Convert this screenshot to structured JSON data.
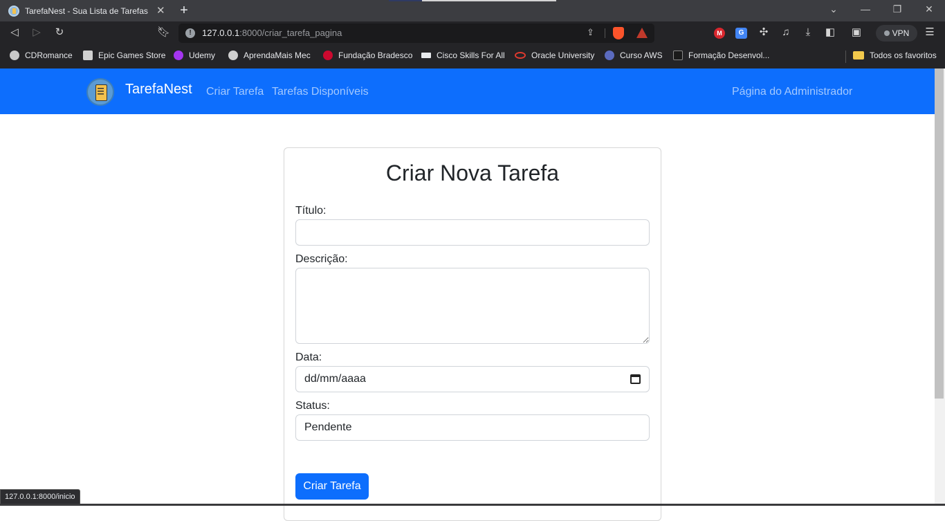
{
  "browser": {
    "tab_title": "TarefaNest - Sua Lista de Tarefas",
    "tab_close": "✕",
    "new_tab": "+",
    "url_host": "127.0.0.1",
    "url_rest": ":8000/criar_tarefa_pagina",
    "vpn_label": "VPN",
    "bookmarks": [
      {
        "label": "CDRomance",
        "icon_color": "#c9c9c9"
      },
      {
        "label": "Epic Games Store",
        "icon_color": "#d0d0d0"
      },
      {
        "label": "Udemy",
        "icon_color": "#a435f0"
      },
      {
        "label": "AprendaMais Mec",
        "icon_color": "#cfcfcf"
      },
      {
        "label": "Fundação Bradesco",
        "icon_color": "#cc092f"
      },
      {
        "label": "Cisco Skills For All",
        "icon_color": "#e8eaed"
      },
      {
        "label": "Oracle University",
        "icon_color": "#e03a2f"
      },
      {
        "label": "Curso AWS",
        "icon_color": "#5b6bbf"
      },
      {
        "label": "Formação Desenvol...",
        "icon_color": "#1a1a1a"
      }
    ],
    "all_bookmarks": "Todos os favoritos",
    "status_url": "127.0.0.1:8000/inicio"
  },
  "navbar": {
    "brand": "TarefaNest",
    "links": [
      "Criar Tarefa",
      "Tarefas Disponíveis"
    ],
    "admin_link": "Página do Administrador",
    "accent": "#0d6efd"
  },
  "form": {
    "title": "Criar Nova Tarefa",
    "title_label": "Título:",
    "title_value": "",
    "description_label": "Descrição:",
    "description_value": "",
    "date_label": "Data:",
    "date_value": "dd/mm/aaaa",
    "status_label": "Status:",
    "status_value": "Pendente",
    "submit_label": "Criar Tarefa"
  }
}
